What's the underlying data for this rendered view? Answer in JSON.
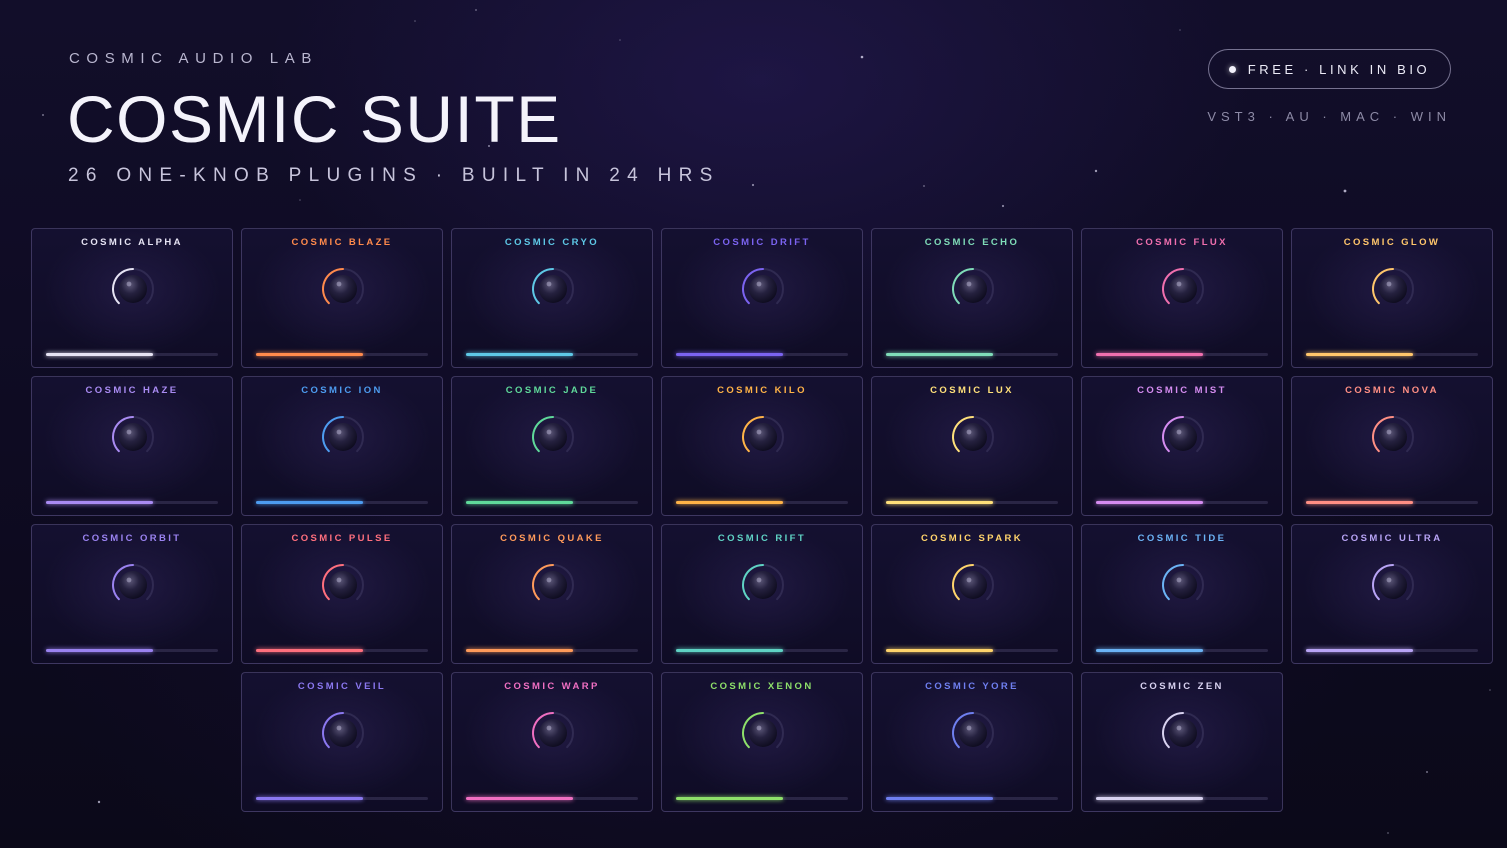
{
  "header": {
    "eyebrow": "COSMIC AUDIO LAB",
    "title": "COSMIC SUITE",
    "subtitle": "26 ONE-KNOB PLUGINS · BUILT IN 24 HRS"
  },
  "badge": {
    "label": "FREE · LINK IN BIO"
  },
  "platforms": "VST3 · AU · MAC · WIN",
  "plugins": [
    {
      "name": "COSMIC ALPHA",
      "color": "#e6e3f3",
      "level": 0.62
    },
    {
      "name": "COSMIC BLAZE",
      "color": "#ff8a4c",
      "level": 0.62
    },
    {
      "name": "COSMIC CRYO",
      "color": "#5ec8e6",
      "level": 0.62
    },
    {
      "name": "COSMIC DRIFT",
      "color": "#7b63f0",
      "level": 0.62
    },
    {
      "name": "COSMIC ECHO",
      "color": "#7fdcb8",
      "level": 0.62
    },
    {
      "name": "COSMIC FLUX",
      "color": "#f06fae",
      "level": 0.62
    },
    {
      "name": "COSMIC GLOW",
      "color": "#ffc66b",
      "level": 0.62
    },
    {
      "name": "COSMIC HAZE",
      "color": "#a98bf2",
      "level": 0.62
    },
    {
      "name": "COSMIC ION",
      "color": "#4d9cf0",
      "level": 0.62
    },
    {
      "name": "COSMIC JADE",
      "color": "#5fd99a",
      "level": 0.62
    },
    {
      "name": "COSMIC KILO",
      "color": "#ffb347",
      "level": 0.62
    },
    {
      "name": "COSMIC LUX",
      "color": "#ffe07a",
      "level": 0.62
    },
    {
      "name": "COSMIC MIST",
      "color": "#d58cf0",
      "level": 0.62
    },
    {
      "name": "COSMIC NOVA",
      "color": "#ff8f84",
      "level": 0.62
    },
    {
      "name": "COSMIC ORBIT",
      "color": "#9a82f0",
      "level": 0.62
    },
    {
      "name": "COSMIC PULSE",
      "color": "#ff6f7d",
      "level": 0.62
    },
    {
      "name": "COSMIC QUAKE",
      "color": "#ff9a5a",
      "level": 0.62
    },
    {
      "name": "COSMIC RIFT",
      "color": "#5fd3c4",
      "level": 0.62
    },
    {
      "name": "COSMIC SPARK",
      "color": "#ffd46b",
      "level": 0.62
    },
    {
      "name": "COSMIC TIDE",
      "color": "#6bb3f5",
      "level": 0.62
    },
    {
      "name": "COSMIC ULTRA",
      "color": "#b8a4f5",
      "level": 0.62
    },
    {
      "name": "COSMIC VEIL",
      "color": "#8b78f0",
      "level": 0.62
    },
    {
      "name": "COSMIC WARP",
      "color": "#f06fc2",
      "level": 0.62
    },
    {
      "name": "COSMIC XENON",
      "color": "#8ee06a",
      "level": 0.62
    },
    {
      "name": "COSMIC YORE",
      "color": "#6f7ff0",
      "level": 0.62
    },
    {
      "name": "COSMIC ZEN",
      "color": "#d8d2f0",
      "level": 0.62
    }
  ]
}
